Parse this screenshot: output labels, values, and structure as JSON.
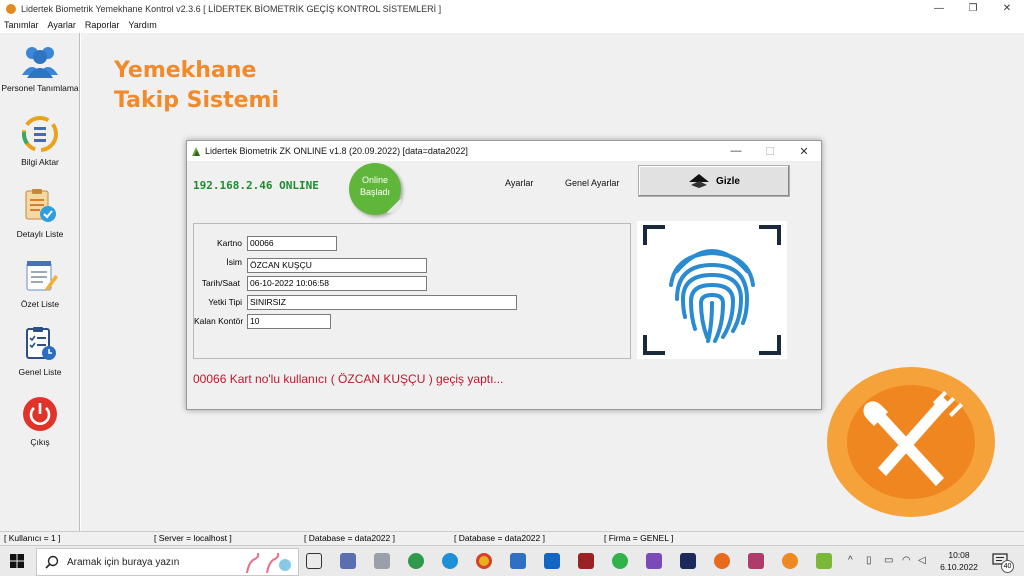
{
  "window": {
    "title": "Lidertek Biometrik Yemekhane Kontrol v2.3.6 [ LİDERTEK BİOMETRİK GEÇİŞ KONTROL SİSTEMLERİ  ]",
    "min_glyph": "—",
    "max_glyph": "❐",
    "close_glyph": "✕"
  },
  "menu": [
    "Tanımlar",
    "Ayarlar",
    "Raporlar",
    "Yardım"
  ],
  "toolbar": {
    "personel": "Personel Tanımlama",
    "bilgi": "Bilgi Aktar",
    "detayli": "Detaylı Liste",
    "ozet": "Özet Liste",
    "genel": "Genel Liste",
    "cikis": "Çıkış"
  },
  "brand": {
    "line1": "Yemekhane",
    "line2": "Takip Sistemi"
  },
  "dialog": {
    "title": "Lidertek Biometrik ZK ONLINE v1.8 (20.09.2022) [data=data2022]",
    "min_glyph": "—",
    "max_glyph": "☐",
    "close_glyph": "✕",
    "ip_status": "192.168.2.46 ONLINE",
    "badge_line1": "Online",
    "badge_line2": "Başladı",
    "ayarlar": "Ayarlar",
    "genel_ayarlar": "Genel Ayarlar",
    "gizle": "Gizle",
    "fields": {
      "kartno_label": "Kartno",
      "kartno_value": "00066",
      "isim_label": "İsim",
      "isim_value": "ÖZCAN KUŞÇU",
      "tarih_label": "Tarih/Saat",
      "tarih_value": "06-10-2022 10:06:58",
      "yetki_label": "Yetki Tipi",
      "yetki_value": "SINIRSIZ",
      "kontor_label": "Kalan Kontör",
      "kontor_value": "10"
    },
    "message": "00066 Kart no'lu kullanıcı ( ÖZCAN KUŞÇU ) geçiş yaptı..."
  },
  "status": {
    "kullanici": "[ Kullanıcı = 1 ]",
    "server": "[ Server = localhost ]",
    "database1": "[ Database = data2022 ]",
    "database2": "[ Database = data2022 ]",
    "firma": "[ Firma = GENEL ]"
  },
  "taskbar": {
    "search_placeholder": "Aramak için buraya yazın",
    "time": "10:08",
    "date": "6.10.2022",
    "notif_count": "40"
  },
  "colors": {
    "brand_orange": "#f08a2a",
    "ip_green": "#1c8c2c",
    "message_red": "#c0182a",
    "fingerprint_blue": "#2a8bd0",
    "badge_green": "#5fb63a"
  }
}
